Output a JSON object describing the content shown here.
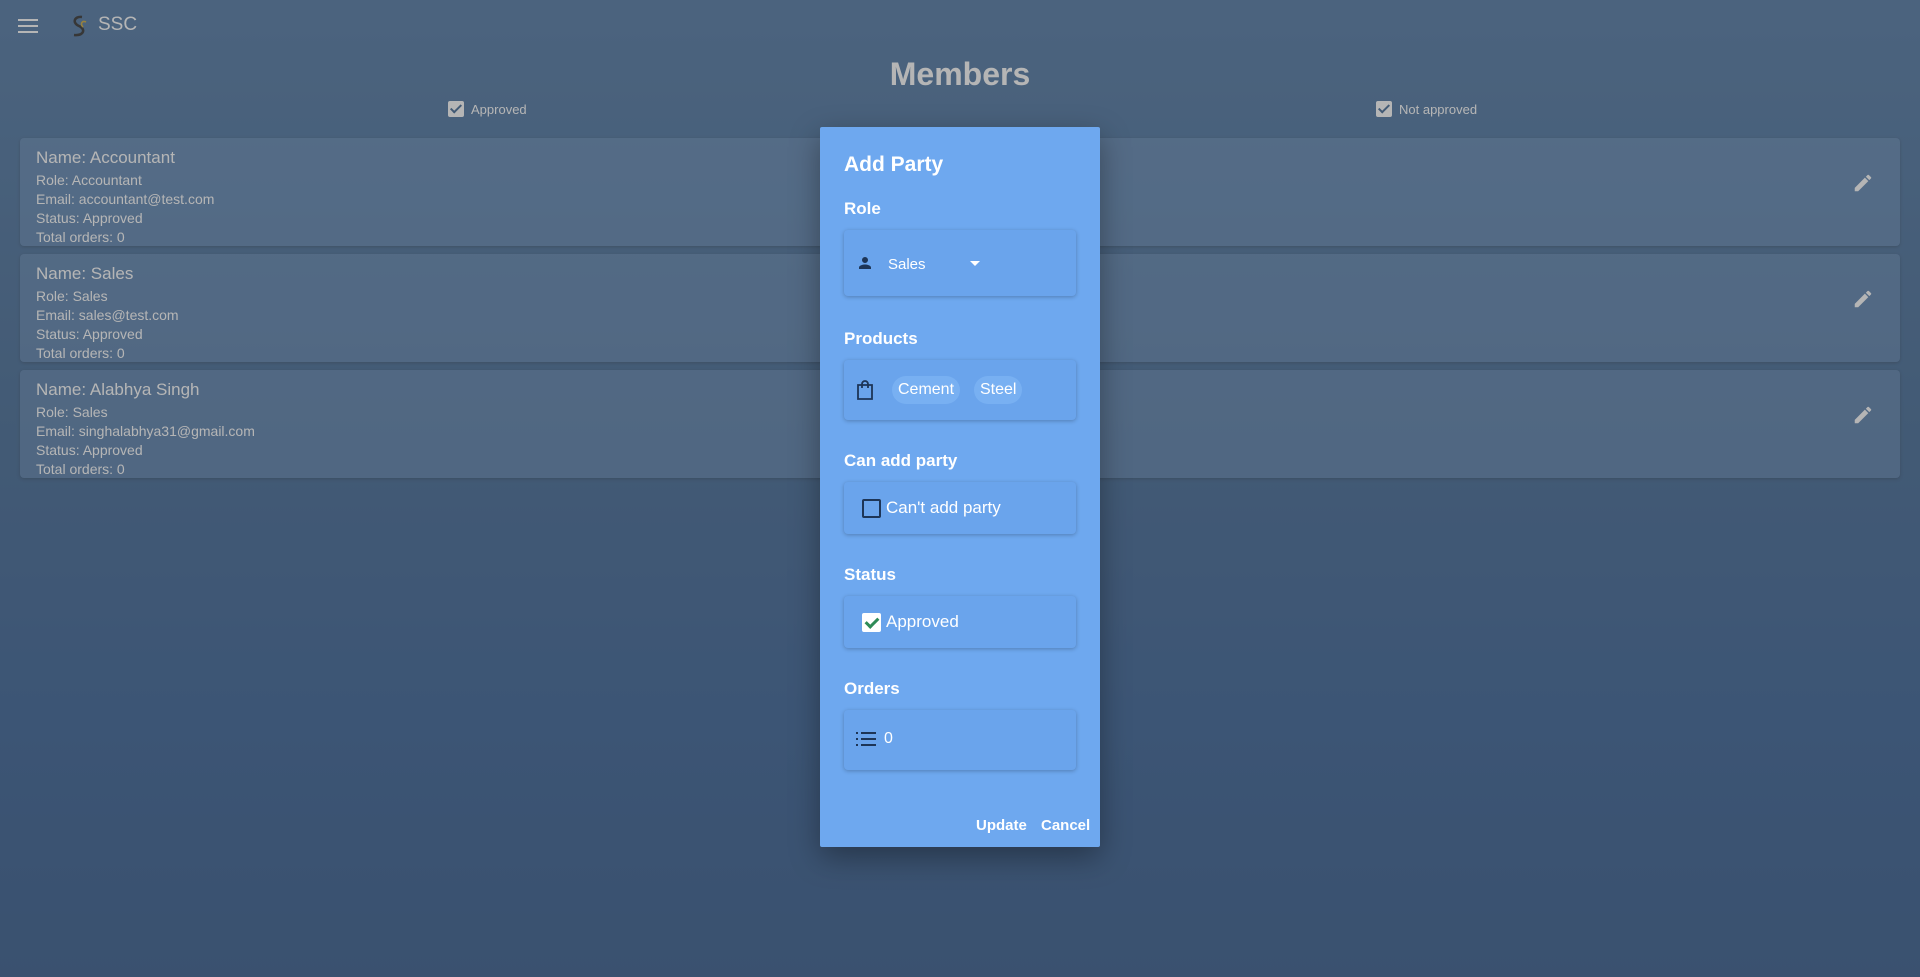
{
  "app": {
    "name": "SSC"
  },
  "page": {
    "title": "Members"
  },
  "filters": {
    "approved_label": "Approved",
    "not_approved_label": "Not approved"
  },
  "members": [
    {
      "name": "Name: Accountant",
      "role": "Role: Accountant",
      "email": "Email: accountant@test.com",
      "status": "Status: Approved",
      "orders": "Total orders: 0"
    },
    {
      "name": "Name: Sales",
      "role": "Role: Sales",
      "email": "Email: sales@test.com",
      "status": "Status: Approved",
      "orders": "Total orders: 0"
    },
    {
      "name": "Name: Alabhya Singh",
      "role": "Role: Sales",
      "email": "Email: singhalabhya31@gmail.com",
      "status": "Status: Approved",
      "orders": "Total orders: 0"
    }
  ],
  "dialog": {
    "title": "Add Party",
    "role_label": "Role",
    "role_value": "Sales",
    "products_label": "Products",
    "products": [
      "Cement",
      "Steel"
    ],
    "can_add_label": "Can add party",
    "can_add_text": "Can't add party",
    "status_label": "Status",
    "status_text": "Approved",
    "orders_label": "Orders",
    "orders_value": "0",
    "update_label": "Update",
    "cancel_label": "Cancel"
  },
  "colors": {
    "dialog_bg": "#6ea8ef",
    "page_bg_top": "#3f6b9c",
    "page_bg_bottom": "#1f4a80"
  },
  "icons": [
    "menu-icon",
    "ssc-logo",
    "edit-icon",
    "person-icon",
    "shopping-bag-icon",
    "list-icon",
    "chevron-down-icon"
  ]
}
